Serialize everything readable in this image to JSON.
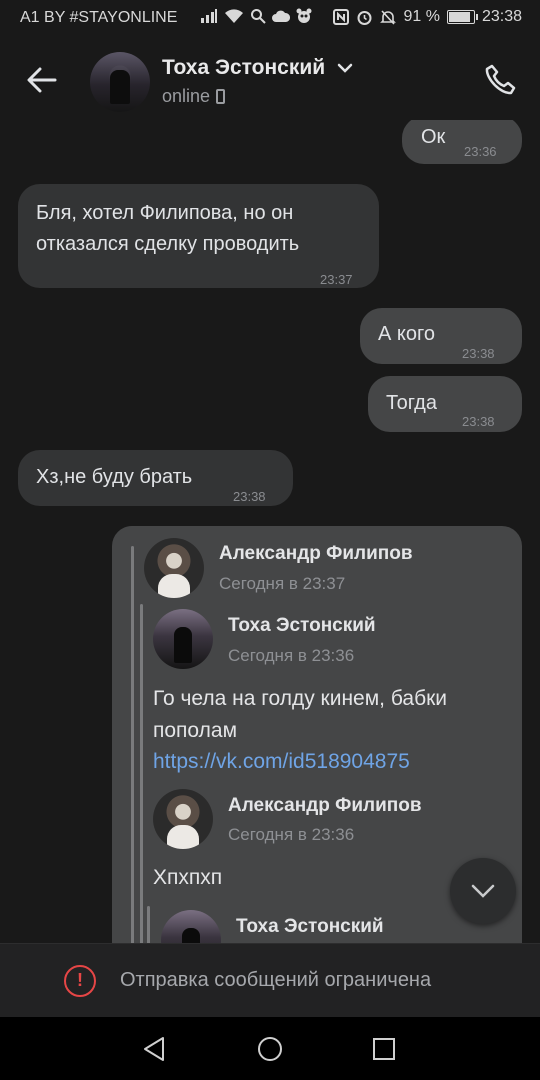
{
  "status_bar": {
    "carrier": "A1 BY #STAYONLINE",
    "battery_percent": "91 %",
    "battery_level": 0.91,
    "time": "23:38",
    "icons": [
      "signal-icon",
      "wifi-icon",
      "search-icon",
      "cloud-icon",
      "panda-icon",
      "nfc-icon",
      "alarm-icon",
      "mute-icon"
    ]
  },
  "header": {
    "contact_name": "Тоха Эстонский",
    "status": "online"
  },
  "messages": [
    {
      "text": "Ок",
      "time": "23:36",
      "direction": "out"
    },
    {
      "text": "Бля, хотел Филипова, но он отказался сделку проводить",
      "time": "23:37",
      "direction": "in"
    },
    {
      "text": "А кого",
      "time": "23:38",
      "direction": "out"
    },
    {
      "text": "Тогда",
      "time": "23:38",
      "direction": "out"
    },
    {
      "text": "Хз,не буду брать",
      "time": "23:38",
      "direction": "in"
    }
  ],
  "forwarded": {
    "level1": {
      "author": "Александр Филипов",
      "date": "Сегодня в 23:37"
    },
    "level2": {
      "author": "Тоха Эстонский",
      "date": "Сегодня в 23:36",
      "text": "Го чела на голду кинем, бабки пополам",
      "link": "https://vk.com/id518904875"
    },
    "level3": {
      "author": "Александр Филипов",
      "date": "Сегодня в 23:36",
      "text": "Хпхпхп"
    },
    "level4": {
      "author": "Тоха Эстонский"
    }
  },
  "restriction": {
    "text": "Отправка сообщений ограничена"
  },
  "colors": {
    "background": "#191919",
    "bubble_out": "#454647",
    "bubble_in": "#333435",
    "link": "#6fa4e6",
    "warning": "#e64646"
  }
}
